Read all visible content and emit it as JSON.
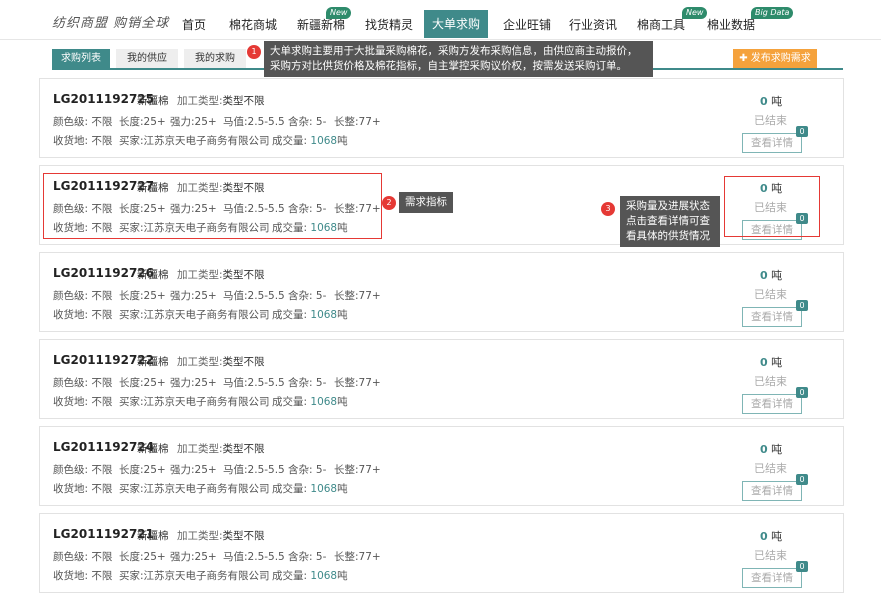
{
  "header": {
    "logo": "纺织商盟 购销全球",
    "nav": [
      {
        "label": "首页",
        "badge": ""
      },
      {
        "label": "棉花商城",
        "badge": ""
      },
      {
        "label": "新疆新棉",
        "badge": "New"
      },
      {
        "label": "找货精灵",
        "badge": ""
      },
      {
        "label": "大单求购",
        "badge": ""
      },
      {
        "label": "企业旺铺",
        "badge": ""
      },
      {
        "label": "行业资讯",
        "badge": ""
      },
      {
        "label": "棉商工具",
        "badge": "New"
      },
      {
        "label": "棉业数据",
        "badge": "Big Data"
      }
    ]
  },
  "tabs": [
    "求购列表",
    "我的供应",
    "我的求购"
  ],
  "publish_label": "✚ 发布求购需求",
  "labels": {
    "ptype": "加工类型:",
    "color": "颜色级: ",
    "length": "长度:",
    "strength": "强力:",
    "mic": "马值:",
    "impurity": "含杂: ",
    "uniformity": "长整:",
    "place": "收货地: ",
    "buyer": "买家:",
    "deal": "成交量: ",
    "ton": "吨",
    "qty_unit": " 吨",
    "detail_button": "查看详情"
  },
  "cards": [
    {
      "code": "LG2011192725",
      "origin": "新疆棉",
      "ptype": "类型不限",
      "color": "不限",
      "length": "25+",
      "strength": "25+",
      "mic": "2.5-5.5",
      "impurity": "5-",
      "uniformity": "77+",
      "place": "不限",
      "buyer": "江苏京天电子商务有限公司",
      "deal": "1068",
      "qty": "0",
      "status": "已结束",
      "count": "0"
    },
    {
      "code": "LG2011192727",
      "origin": "新疆棉",
      "ptype": "类型不限",
      "color": "不限",
      "length": "25+",
      "strength": "25+",
      "mic": "2.5-5.5",
      "impurity": "5-",
      "uniformity": "77+",
      "place": "不限",
      "buyer": "江苏京天电子商务有限公司",
      "deal": "1068",
      "qty": "0",
      "status": "已结束",
      "count": "0"
    },
    {
      "code": "LG2011192726",
      "origin": "新疆棉",
      "ptype": "类型不限",
      "color": "不限",
      "length": "25+",
      "strength": "25+",
      "mic": "2.5-5.5",
      "impurity": "5-",
      "uniformity": "77+",
      "place": "不限",
      "buyer": "江苏京天电子商务有限公司",
      "deal": "1068",
      "qty": "0",
      "status": "已结束",
      "count": "0"
    },
    {
      "code": "LG2011192722",
      "origin": "新疆棉",
      "ptype": "类型不限",
      "color": "不限",
      "length": "25+",
      "strength": "25+",
      "mic": "2.5-5.5",
      "impurity": "5-",
      "uniformity": "77+",
      "place": "不限",
      "buyer": "江苏京天电子商务有限公司",
      "deal": "1068",
      "qty": "0",
      "status": "已结束",
      "count": "0"
    },
    {
      "code": "LG2011192724",
      "origin": "新疆棉",
      "ptype": "类型不限",
      "color": "不限",
      "length": "25+",
      "strength": "25+",
      "mic": "2.5-5.5",
      "impurity": "5-",
      "uniformity": "77+",
      "place": "不限",
      "buyer": "江苏京天电子商务有限公司",
      "deal": "1068",
      "qty": "0",
      "status": "已结束",
      "count": "0"
    },
    {
      "code": "LG2011192721",
      "origin": "新疆棉",
      "ptype": "类型不限",
      "color": "不限",
      "length": "25+",
      "strength": "25+",
      "mic": "2.5-5.5",
      "impurity": "5-",
      "uniformity": "77+",
      "place": "不限",
      "buyer": "江苏京天电子商务有限公司",
      "deal": "1068",
      "qty": "0",
      "status": "已结束",
      "count": "0"
    }
  ],
  "annotations": {
    "n1": "1",
    "tip1_line1": "大单求购主要用于大批量采购棉花，采购方发布采购信息，由供应商主动报价，",
    "tip1_line2": "采购方对比供货价格及棉花指标，自主掌控采购议价权，按需发送采购订单。",
    "n2": "2",
    "tip2": "需求指标",
    "n3": "3",
    "tip3_line1": "采购量及进展状态",
    "tip3_line2": "点击查看详情可查",
    "tip3_line3": "看具体的供货情况"
  },
  "colors": {
    "accent": "#3f8a8a",
    "publish": "#f5a23c",
    "annotation": "#e53935"
  }
}
